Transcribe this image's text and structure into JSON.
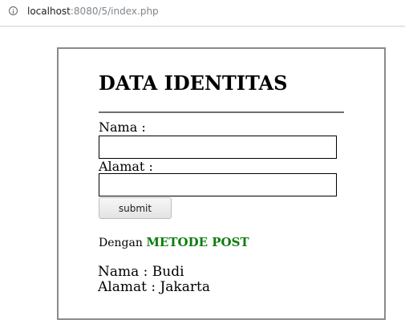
{
  "browser": {
    "url_host": "localhost",
    "url_path": ":8080/5/index.php"
  },
  "form": {
    "title": "DATA IDENTITAS",
    "nama_label": "Nama :",
    "nama_value": "",
    "alamat_label": "Alamat :",
    "alamat_value": "",
    "submit_label": "submit"
  },
  "method_info": {
    "prefix": "Dengan",
    "method": "METODE POST",
    "highlight_color": "#0b7d0b"
  },
  "result": {
    "nama_line": "Nama : Budi",
    "alamat_line": "Alamat : Jakarta"
  }
}
